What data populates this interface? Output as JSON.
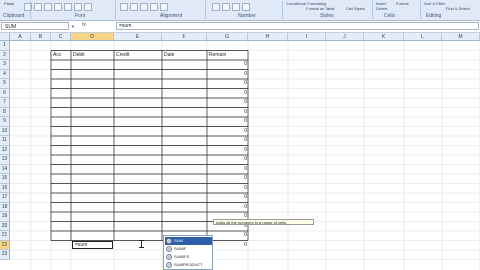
{
  "ribbon": {
    "top_items": [
      "Paste",
      "Conditional Formatting",
      "Format as Table",
      "Cell Styles",
      "Insert",
      "Delete",
      "Format",
      "Sort & Filter",
      "Find & Select"
    ],
    "groups": [
      "Clipboard",
      "Font",
      "Alignment",
      "Number",
      "Styles",
      "Cells",
      "Editing"
    ]
  },
  "formula_bar": {
    "name_box": "SUM",
    "fx_symbol": "fx",
    "content": "=sum"
  },
  "columns": [
    "A",
    "B",
    "C",
    "D",
    "E",
    "F",
    "G",
    "H",
    "I",
    "J",
    "K",
    "L",
    "M"
  ],
  "active_column": "D",
  "rows": [
    "1",
    "2",
    "3",
    "4",
    "5",
    "6",
    "7",
    "8",
    "9",
    "10",
    "11",
    "12",
    "13",
    "14",
    "15",
    "16",
    "17",
    "18",
    "19",
    "20",
    "21",
    "22",
    "23"
  ],
  "active_row": "22",
  "table": {
    "headers": [
      "Acc",
      "Debit",
      "Credit",
      "Date",
      "Remain"
    ],
    "remain_values": [
      "0",
      "0",
      "0",
      "0",
      "0",
      "0",
      "0",
      "0",
      "0",
      "0",
      "0",
      "0",
      "0",
      "0",
      "0",
      "0",
      "0",
      "0",
      "0",
      "0"
    ],
    "editing_cell": "=sum"
  },
  "tooltip": "Adds all the numbers in a range of cells",
  "autocomplete": {
    "items": [
      "SUM",
      "SUMIF",
      "SUMIFS",
      "SUMPRODUCT"
    ],
    "selected": "SUM"
  },
  "colors": {
    "ribbon_bg": "#dfe9f7",
    "header_bg": "#e4ecf7",
    "active_header": "#f8d586",
    "selection": "#2d5fa8"
  }
}
